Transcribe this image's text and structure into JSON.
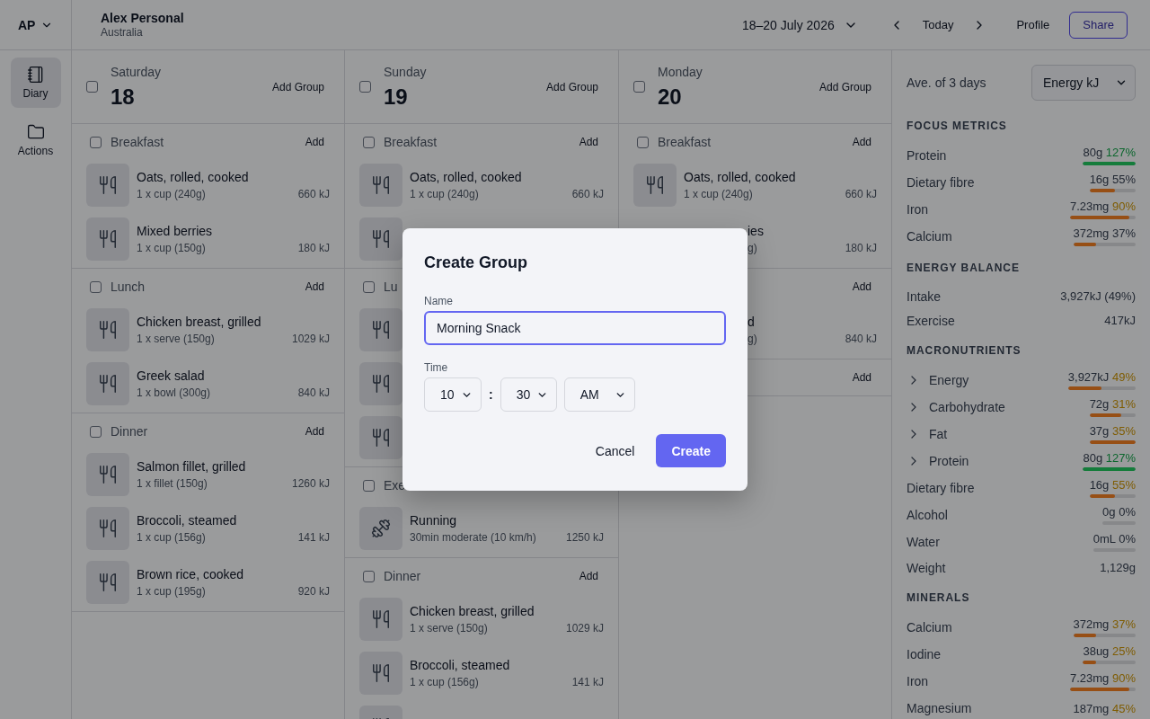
{
  "account": {
    "initials": "AP"
  },
  "profile": {
    "name": "Alex Personal",
    "region": "Australia"
  },
  "toolbar": {
    "date_range": "18–20 July 2026",
    "today": "Today",
    "profile": "Profile",
    "share": "Share"
  },
  "sidebar": {
    "items": [
      {
        "label": "Diary",
        "selected": true
      },
      {
        "label": "Actions",
        "selected": false
      }
    ]
  },
  "days": [
    {
      "weekday": "Saturday",
      "date": "18",
      "checked": false,
      "add_label": "Add Group",
      "groups": [
        {
          "name": "Breakfast",
          "checked": false,
          "add_label": "Add",
          "entries": [
            {
              "kind": "food",
              "name": "Oats, rolled, cooked",
              "serving": "1 x cup (240g)",
              "energy": "660 kJ"
            },
            {
              "kind": "food",
              "name": "Mixed berries",
              "serving": "1 x cup (150g)",
              "energy": "180 kJ"
            }
          ]
        },
        {
          "name": "Lunch",
          "checked": false,
          "add_label": "Add",
          "entries": [
            {
              "kind": "food",
              "name": "Chicken breast, grilled",
              "serving": "1 x serve (150g)",
              "energy": "1029 kJ"
            },
            {
              "kind": "food",
              "name": "Greek salad",
              "serving": "1 x bowl (300g)",
              "energy": "840 kJ"
            }
          ]
        },
        {
          "name": "Dinner",
          "checked": false,
          "add_label": "Add",
          "entries": [
            {
              "kind": "food",
              "name": "Salmon fillet, grilled",
              "serving": "1 x fillet (150g)",
              "energy": "1260 kJ"
            },
            {
              "kind": "food",
              "name": "Broccoli, steamed",
              "serving": "1 x cup (156g)",
              "energy": "141 kJ"
            },
            {
              "kind": "food",
              "name": "Brown rice, cooked",
              "serving": "1 x cup (195g)",
              "energy": "920 kJ"
            }
          ]
        }
      ]
    },
    {
      "weekday": "Sunday",
      "date": "19",
      "checked": false,
      "add_label": "Add Group",
      "groups": [
        {
          "name": "Breakfast",
          "checked": false,
          "add_label": "Add",
          "entries": [
            {
              "kind": "food",
              "name": "Oats, rolled, cooked",
              "serving": "1 x cup (240g)",
              "energy": "660 kJ"
            },
            {
              "kind": "food"
            }
          ]
        },
        {
          "name": "Lu",
          "checked": false,
          "entries": [
            {
              "kind": "food"
            },
            {
              "kind": "food"
            },
            {
              "kind": "food"
            }
          ]
        },
        {
          "name": "Exe",
          "checked": false,
          "entries": [
            {
              "kind": "exercise",
              "name": "Running",
              "serving": "30min moderate (10 km/h)",
              "energy": "1250 kJ"
            }
          ]
        },
        {
          "name": "Dinner",
          "checked": false,
          "add_label": "Add",
          "entries": [
            {
              "kind": "food",
              "name": "Chicken breast, grilled",
              "serving": "1 x serve (150g)",
              "energy": "1029 kJ"
            },
            {
              "kind": "food",
              "name": "Broccoli, steamed",
              "serving": "1 x cup (156g)",
              "energy": "141 kJ"
            },
            {
              "kind": "food"
            }
          ]
        }
      ]
    },
    {
      "weekday": "Monday",
      "date": "20",
      "checked": false,
      "add_label": "Add Group",
      "groups": [
        {
          "name": "Breakfast",
          "checked": false,
          "add_label": "Add",
          "entries": [
            {
              "kind": "food",
              "name": "Oats, rolled, cooked",
              "serving": "1 x cup (240g)",
              "energy": "660 kJ"
            },
            {
              "kind": "food",
              "occluded": true,
              "name": "ies",
              "serving": "g)",
              "energy": "180 kJ"
            }
          ]
        },
        {
          "add_label": "Add",
          "entries": [
            {
              "kind": "food",
              "occluded": true,
              "name": "d",
              "serving": "g)",
              "energy": "840 kJ"
            }
          ]
        },
        {
          "add_label": "Add"
        }
      ]
    }
  ],
  "summary": {
    "caption": "Ave. of 3 days",
    "metric": "Energy kJ",
    "sections": [
      {
        "title": "FOCUS METRICS",
        "rows": [
          {
            "kind": "bar",
            "label": "Protein",
            "amount": "80g",
            "percent": "127%",
            "highlighted": true,
            "met": true,
            "level": 1
          },
          {
            "kind": "bar",
            "label": "Dietary fibre",
            "amount": "16g",
            "percent": "55%",
            "highlighted": false,
            "met": false,
            "level": 0.55
          },
          {
            "kind": "bar",
            "label": "Iron",
            "amount": "7.23mg",
            "percent": "90%",
            "highlighted": true,
            "met": false,
            "level": 0.9
          },
          {
            "kind": "bar",
            "label": "Calcium",
            "amount": "372mg",
            "percent": "37%",
            "highlighted": false,
            "met": false,
            "level": 0.37
          }
        ]
      },
      {
        "title": "ENERGY BALANCE",
        "rows": [
          {
            "kind": "value",
            "label": "Intake",
            "value": "3,927kJ (49%)"
          },
          {
            "kind": "value",
            "label": "Exercise",
            "value": "417kJ"
          }
        ]
      },
      {
        "title": "MACRONUTRIENTS",
        "rows": [
          {
            "kind": "group",
            "label": "Energy",
            "expanded": false,
            "amount": "3,927kJ",
            "percent": "49%",
            "highlighted": true,
            "met": false,
            "level": 0.49
          },
          {
            "kind": "group",
            "label": "Carbohydrate",
            "expanded": false,
            "amount": "72g",
            "percent": "31%",
            "highlighted": true,
            "met": false,
            "level": 0.68
          },
          {
            "kind": "group",
            "label": "Fat",
            "expanded": false,
            "amount": "37g",
            "percent": "35%",
            "highlighted": true,
            "met": false,
            "level": 1
          },
          {
            "kind": "group",
            "label": "Protein",
            "expanded": false,
            "amount": "80g",
            "percent": "127%",
            "highlighted": true,
            "met": true,
            "level": 1
          },
          {
            "kind": "bar",
            "label": "Dietary fibre",
            "amount": "16g",
            "percent": "55%",
            "highlighted": true,
            "met": false,
            "level": 0.55
          },
          {
            "kind": "bar",
            "label": "Alcohol",
            "amount": "0g",
            "percent": "0%",
            "highlighted": false
          },
          {
            "kind": "bar",
            "label": "Water",
            "amount": "0mL",
            "percent": "0%",
            "highlighted": false
          },
          {
            "kind": "value",
            "label": "Weight",
            "value": "1,129g"
          }
        ]
      },
      {
        "title": "MINERALS",
        "rows": [
          {
            "kind": "bar",
            "label": "Calcium",
            "amount": "372mg",
            "percent": "37%",
            "highlighted": true,
            "met": false,
            "level": 0.37
          },
          {
            "kind": "bar",
            "label": "Iodine",
            "amount": "38ug",
            "percent": "25%",
            "highlighted": true,
            "met": false,
            "level": 0.25
          },
          {
            "kind": "bar",
            "label": "Iron",
            "amount": "7.23mg",
            "percent": "90%",
            "highlighted": true,
            "met": false,
            "level": 0.9
          },
          {
            "kind": "reading",
            "label": "Magnesium",
            "amount": "187mg",
            "percent": "45%",
            "highlighted": true,
            "met": false
          }
        ]
      }
    ]
  },
  "dialog": {
    "title": "Create Group",
    "name_field": {
      "label": "Name",
      "value": "Morning Snack",
      "focused": true
    },
    "time_field": {
      "label": "Time",
      "hour": "10",
      "separator": ":",
      "minute": "30",
      "period": "AM"
    },
    "actions": [
      {
        "label": "Cancel",
        "kind": "secondary"
      },
      {
        "label": "Create",
        "kind": "primary"
      }
    ]
  }
}
